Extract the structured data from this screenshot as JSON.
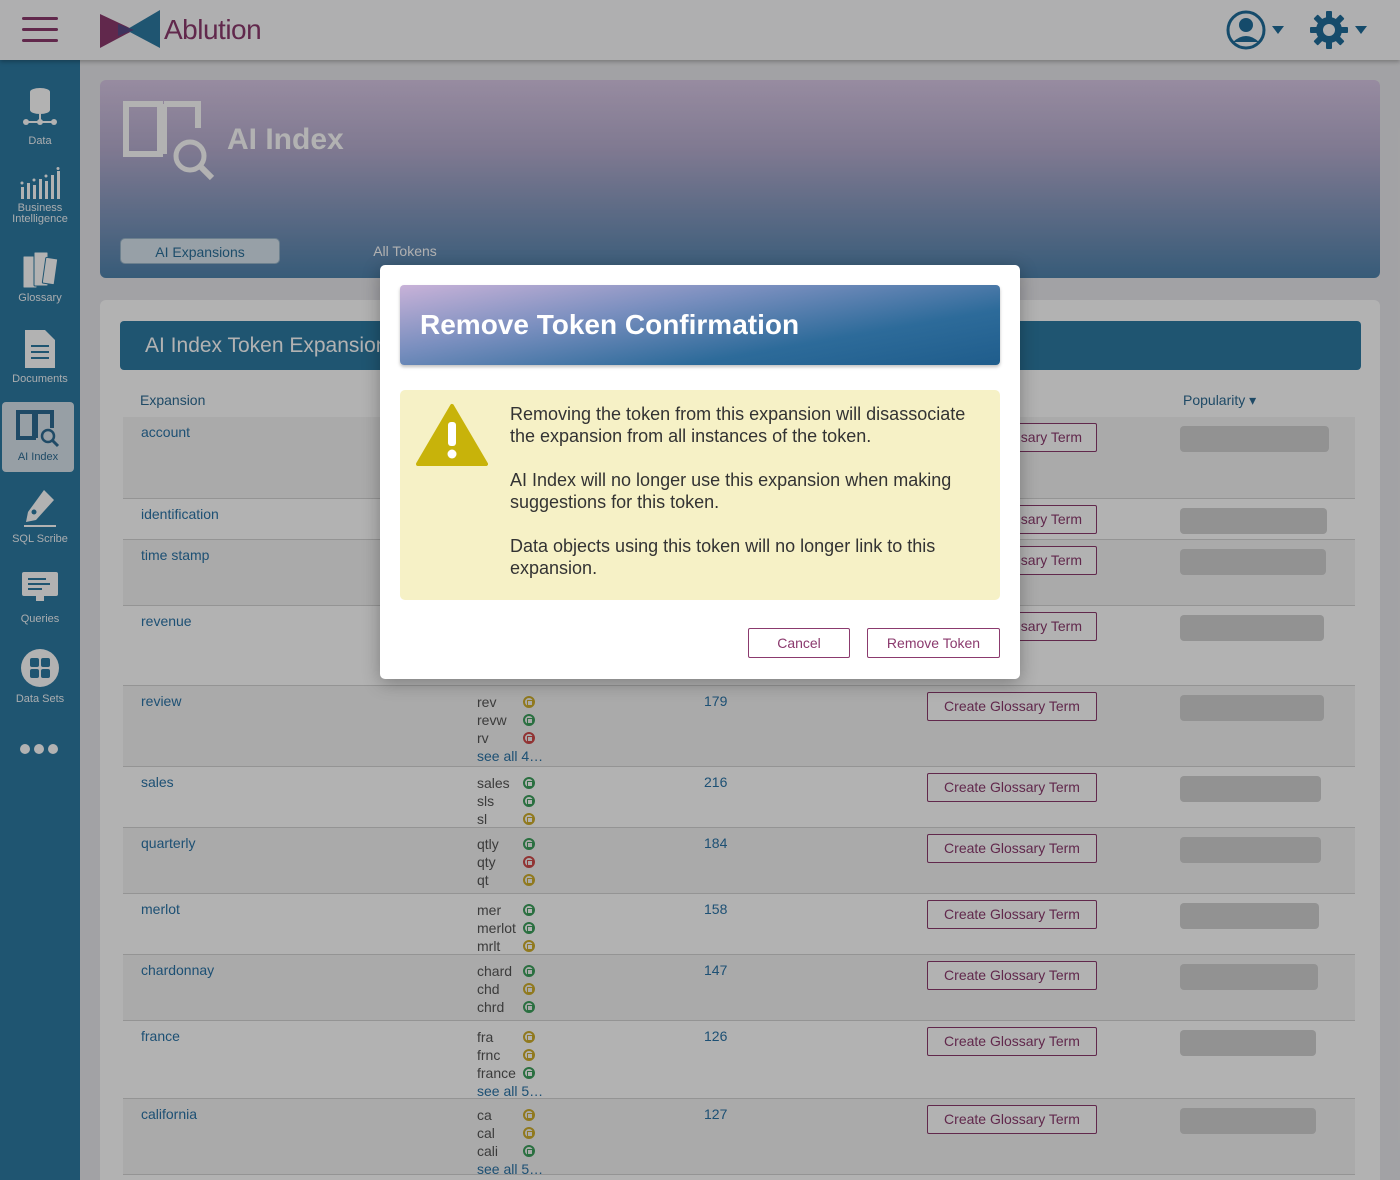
{
  "app": {
    "name": "Ablution"
  },
  "sidebar": {
    "items": [
      {
        "label": "Data",
        "icon": "database-icon"
      },
      {
        "label": "Business Intelligence",
        "icon": "bar-chart-icon"
      },
      {
        "label": "Glossary",
        "icon": "books-icon"
      },
      {
        "label": "Documents",
        "icon": "document-icon"
      },
      {
        "label": "AI Index",
        "icon": "book-search-icon"
      },
      {
        "label": "SQL Scribe",
        "icon": "pen-icon"
      },
      {
        "label": "Queries",
        "icon": "monitor-icon"
      },
      {
        "label": "Data Sets",
        "icon": "grid-circle-icon"
      }
    ]
  },
  "hero": {
    "title": "AI Index",
    "tabs": [
      {
        "label": "AI Expansions"
      },
      {
        "label": "All Tokens"
      }
    ]
  },
  "card": {
    "title": "AI Index Token Expansions",
    "columns": {
      "expansion": "Expansion",
      "popularity": "Popularity ▾"
    },
    "glossary_button": "Create Glossary Term",
    "rows": [
      {
        "expansion": "account",
        "tokens": [],
        "count": "",
        "popularity": 0.93,
        "glossary_partial": "sary Term"
      },
      {
        "expansion": "identification",
        "tokens": [],
        "count": "",
        "popularity": 0.92,
        "glossary_partial": "sary Term"
      },
      {
        "expansion": "time stamp",
        "tokens": [],
        "count": "",
        "popularity": 0.91,
        "glossary_partial": "sary Term"
      },
      {
        "expansion": "revenue",
        "tokens": [],
        "count": "",
        "popularity": 0.9,
        "glossary_partial": "sary Term"
      },
      {
        "expansion": "review",
        "tokens": [
          {
            "name": "rev",
            "status": "yellow"
          },
          {
            "name": "revw",
            "status": "green"
          },
          {
            "name": "rv",
            "status": "red"
          }
        ],
        "see_all": "see all 4…",
        "count": "179",
        "popularity": 0.9
      },
      {
        "expansion": "sales",
        "tokens": [
          {
            "name": "sales",
            "status": "green"
          },
          {
            "name": "sls",
            "status": "green"
          },
          {
            "name": "sl",
            "status": "yellow"
          }
        ],
        "see_all": "",
        "count": "216",
        "popularity": 0.88
      },
      {
        "expansion": "quarterly",
        "tokens": [
          {
            "name": "qtly",
            "status": "green"
          },
          {
            "name": "qty",
            "status": "red"
          },
          {
            "name": "qt",
            "status": "yellow"
          }
        ],
        "see_all": "",
        "count": "184",
        "popularity": 0.88
      },
      {
        "expansion": "merlot",
        "tokens": [
          {
            "name": "mer",
            "status": "green"
          },
          {
            "name": "merlot",
            "status": "green"
          },
          {
            "name": "mrlt",
            "status": "yellow"
          }
        ],
        "see_all": "",
        "count": "158",
        "popularity": 0.87
      },
      {
        "expansion": "chardonnay",
        "tokens": [
          {
            "name": "chard",
            "status": "green"
          },
          {
            "name": "chd",
            "status": "yellow"
          },
          {
            "name": "chrd",
            "status": "green"
          }
        ],
        "see_all": "",
        "count": "147",
        "popularity": 0.86
      },
      {
        "expansion": "france",
        "tokens": [
          {
            "name": "fra",
            "status": "yellow"
          },
          {
            "name": "frnc",
            "status": "yellow"
          },
          {
            "name": "france",
            "status": "green"
          }
        ],
        "see_all": "see all 5…",
        "count": "126",
        "popularity": 0.85
      },
      {
        "expansion": "california",
        "tokens": [
          {
            "name": "ca",
            "status": "yellow"
          },
          {
            "name": "cal",
            "status": "yellow"
          },
          {
            "name": "cali",
            "status": "green"
          }
        ],
        "see_all": "see all 5…",
        "count": "127",
        "popularity": 0.85
      }
    ]
  },
  "modal": {
    "title": "Remove Token Confirmation",
    "messages": [
      "Removing the token from this expansion will disassociate the expansion from all instances of the token.",
      "AI Index will no longer use this expansion when making suggestions for this token.",
      "Data objects using this token will no longer link to this expansion."
    ],
    "cancel_label": "Cancel",
    "confirm_label": "Remove Token"
  },
  "colors": {
    "brand": "#8b3a6e",
    "primary": "#2d7aa3",
    "warning": "#c8b30a",
    "warning_bg": "#f6f1c6"
  }
}
